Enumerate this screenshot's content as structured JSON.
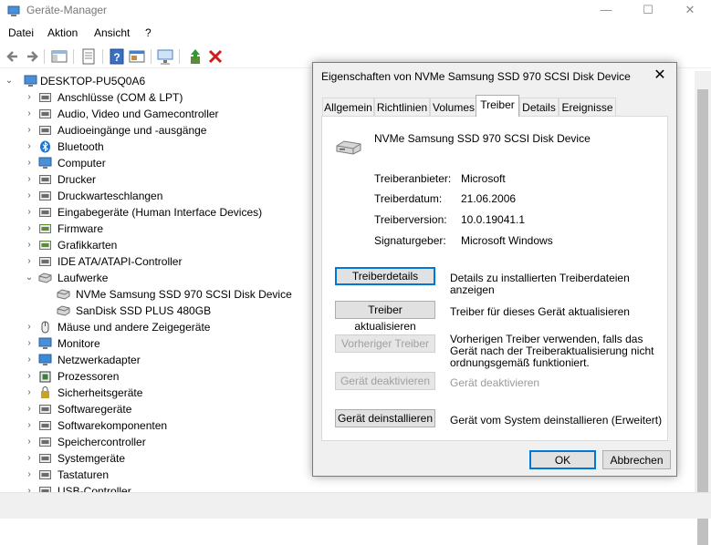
{
  "window": {
    "title": "Geräte-Manager"
  },
  "menu": [
    "Datei",
    "Aktion",
    "Ansicht",
    "?"
  ],
  "tree": {
    "root": "DESKTOP-PU5Q0A6",
    "nodes": [
      "Anschlüsse (COM & LPT)",
      "Audio, Video und Gamecontroller",
      "Audioeingänge und -ausgänge",
      "Bluetooth",
      "Computer",
      "Drucker",
      "Druckwarteschlangen",
      "Eingabegeräte (Human Interface Devices)",
      "Firmware",
      "Grafikkarten",
      "IDE ATA/ATAPI-Controller",
      "Laufwerke",
      "NVMe Samsung SSD 970 SCSI Disk Device",
      "SanDisk SSD PLUS 480GB",
      "Mäuse und andere Zeigegeräte",
      "Monitore",
      "Netzwerkadapter",
      "Prozessoren",
      "Sicherheitsgeräte",
      "Softwaregeräte",
      "Softwarekomponenten",
      "Speichercontroller",
      "Systemgeräte",
      "Tastaturen",
      "USB-Controller"
    ]
  },
  "dialog": {
    "title": "Eigenschaften von NVMe Samsung SSD 970 SCSI Disk Device",
    "tabs": [
      "Allgemein",
      "Richtlinien",
      "Volumes",
      "Treiber",
      "Details",
      "Ereignisse"
    ],
    "active_tab": "Treiber",
    "device_name": "NVMe Samsung SSD 970 SCSI Disk Device",
    "properties": [
      {
        "label": "Treiberanbieter:",
        "value": "Microsoft"
      },
      {
        "label": "Treiberdatum:",
        "value": "21.06.2006"
      },
      {
        "label": "Treiberversion:",
        "value": "10.0.19041.1"
      },
      {
        "label": "Signaturgeber:",
        "value": "Microsoft Windows"
      }
    ],
    "actions": [
      {
        "button": "Treiberdetails",
        "description": "Details zu installierten Treiberdateien anzeigen",
        "enabled": true
      },
      {
        "button": "Treiber aktualisieren",
        "description": "Treiber für dieses Gerät aktualisieren",
        "enabled": true
      },
      {
        "button": "Vorheriger Treiber",
        "description": "Vorherigen Treiber verwenden, falls das Gerät nach der Treiberaktualisierung nicht ordnungsgemäß funktioniert.",
        "enabled": false
      },
      {
        "button": "Gerät deaktivieren",
        "description": "Gerät deaktivieren",
        "enabled": false
      },
      {
        "button": "Gerät deinstallieren",
        "description": "Gerät vom System deinstallieren (Erweitert)",
        "enabled": true
      }
    ],
    "ok_label": "OK",
    "cancel_label": "Abbrechen"
  },
  "colors": {
    "accent": "#0078d7",
    "disabled_text": "#a0a0a0",
    "dialog_bg": "#f0f0f0"
  }
}
